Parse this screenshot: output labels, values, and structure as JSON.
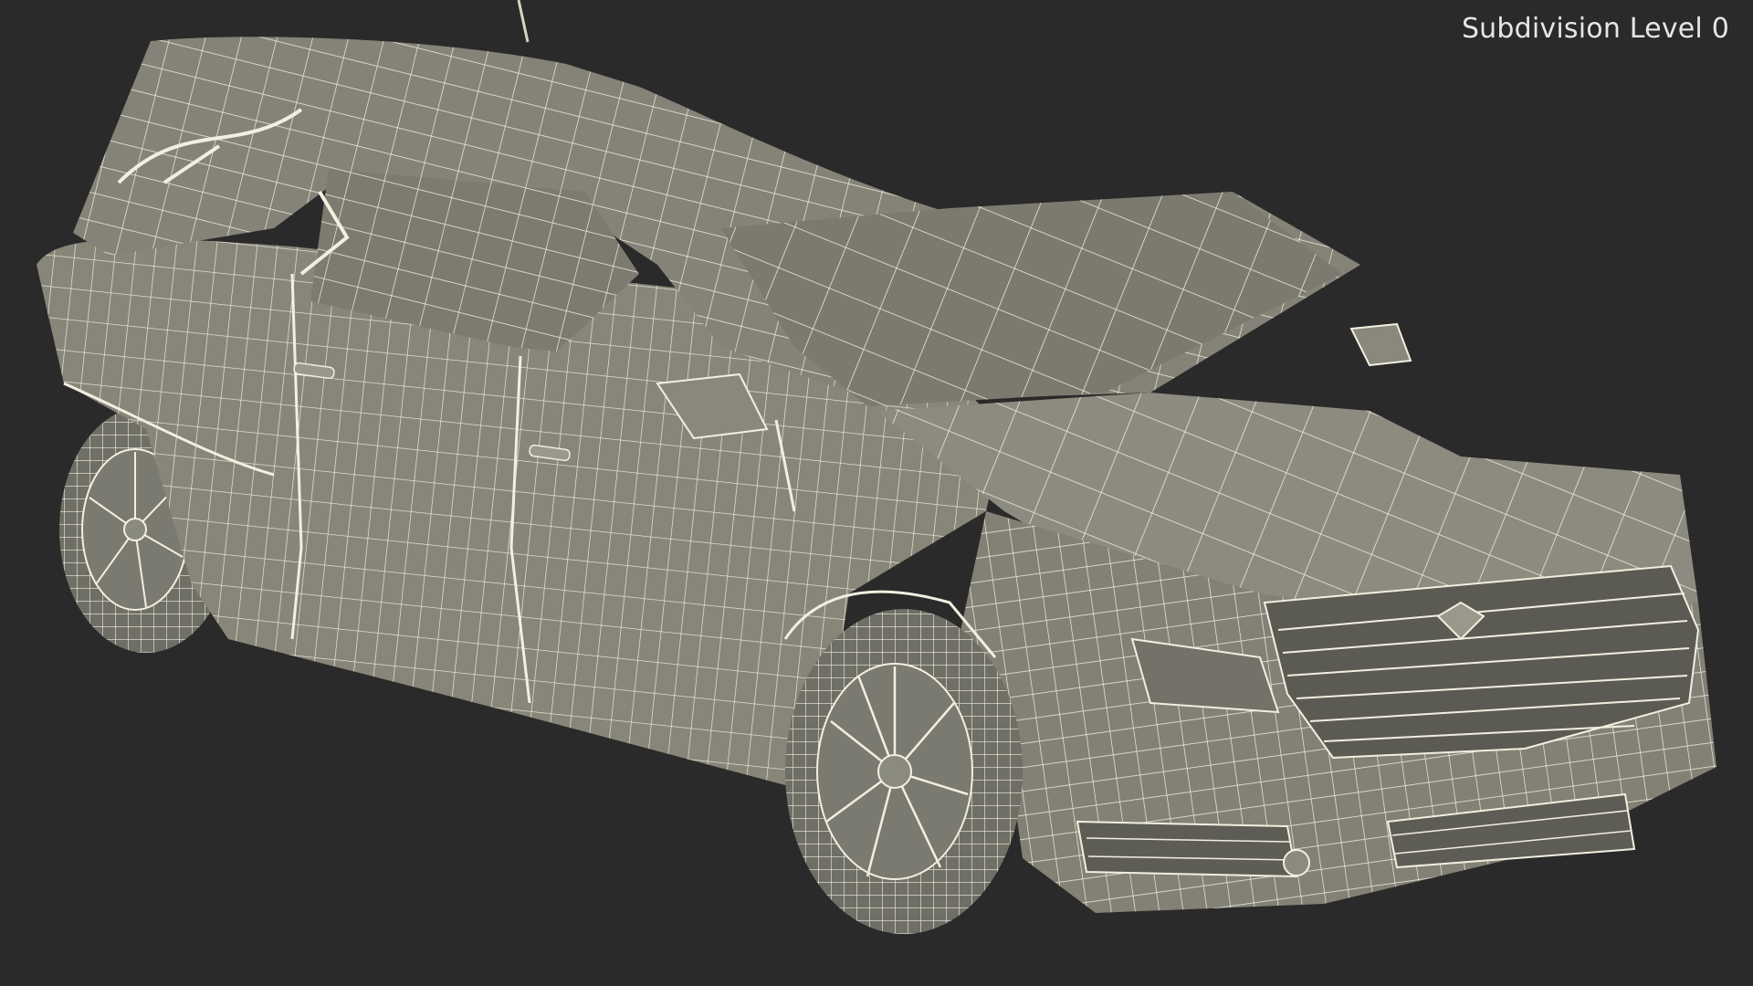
{
  "overlay": {
    "subdivision_label": "Subdivision Level 0"
  },
  "scene": {
    "subject": "hearse-wireframe-model",
    "background_color": "#2a2a2a",
    "surface_color": "#8a8a7e",
    "wire_color": "#f2efe0"
  }
}
